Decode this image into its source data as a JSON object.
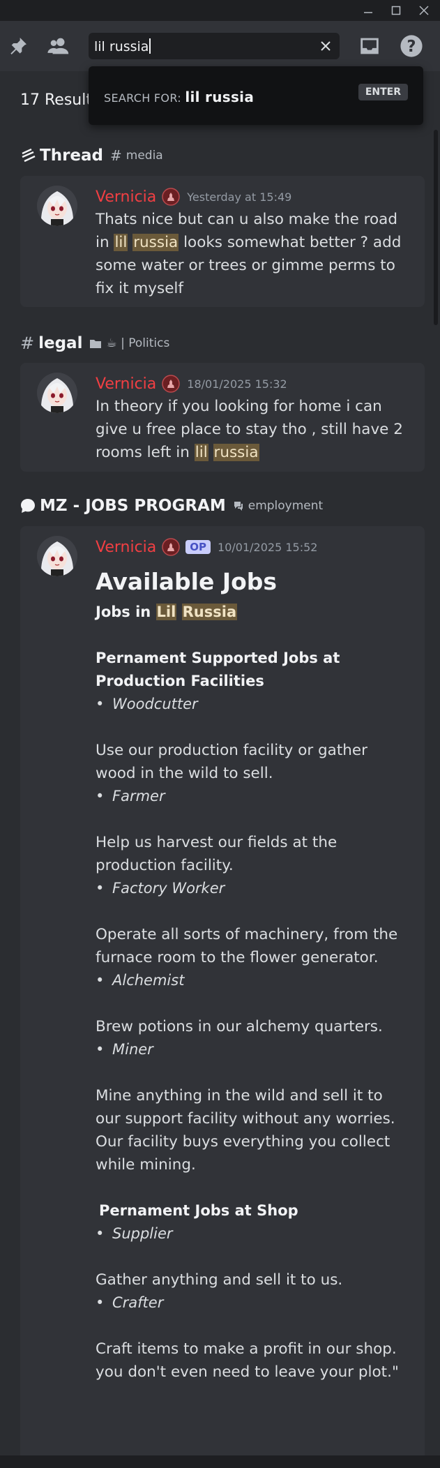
{
  "search": {
    "query": "lil russia",
    "popup_prefix": "SEARCH FOR:",
    "popup_query": "lil russia",
    "enter_key": "ENTER"
  },
  "results": {
    "count_label": "17 Results"
  },
  "groups": [
    {
      "type_icon": "thread-icon",
      "name": "Thread",
      "sub_icon": "hash-icon",
      "sub": "media",
      "message": {
        "author": "Vernicia",
        "timestamp": "Yesterday at 15:49",
        "parts": [
          "Thats nice but can u also make the road in ",
          "lil",
          " ",
          "russia",
          " looks somewhat better ? add some water or trees or gimme perms to fix it myself"
        ]
      }
    },
    {
      "type_icon": "hash-icon",
      "name": "legal",
      "sub_icon": "folder-icon",
      "sub": "☕ | Politics",
      "message": {
        "author": "Vernicia",
        "timestamp": "18/01/2025 15:32",
        "parts": [
          "In theory if you looking for home i can give u free place to stay tho , still have 2 rooms left in ",
          "lil",
          " ",
          "russia"
        ]
      }
    },
    {
      "type_icon": "chat-bubble-icon",
      "name": "MZ - JOBS PROGRAM",
      "sub_icon": "forum-icon",
      "sub": "employment",
      "message": {
        "author": "Vernicia",
        "op_badge": "OP",
        "timestamp": "10/01/2025 15:52",
        "heading": "Available Jobs",
        "subheading_prefix": "Jobs in ",
        "subheading_hl1": "Lil",
        "subheading_hl2": "Russia",
        "section1_title": "Pernament Supported Jobs at Production Facilities",
        "jobs1": [
          {
            "name": "Woodcutter",
            "desc": "Use our production facility or gather wood in the wild to sell."
          },
          {
            "name": "Farmer",
            "desc": "Help us harvest our fields at the production facility."
          },
          {
            "name": "Factory Worker",
            "desc": "Operate all sorts of machinery, from the furnace room to the flower generator."
          },
          {
            "name": "Alchemist",
            "desc": "Brew potions in our alchemy quarters."
          },
          {
            "name": "Miner",
            "desc": "Mine anything in the wild and sell it to our support facility without any worries. Our facility buys everything you collect while mining."
          }
        ],
        "section2_title": "Pernament Jobs at Shop",
        "jobs2": [
          {
            "name": "Supplier",
            "desc": "Gather anything and sell it to us."
          },
          {
            "name": "Crafter",
            "desc": "Craft items to make a profit in our shop. you don't even need to leave your plot.\""
          }
        ]
      }
    }
  ]
}
